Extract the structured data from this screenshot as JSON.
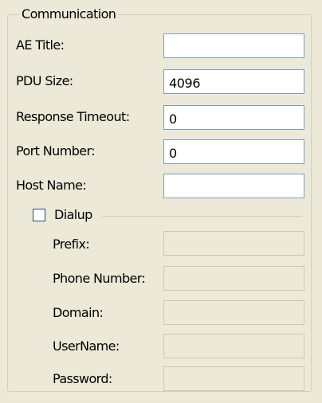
{
  "communication": {
    "group_title": "Communication",
    "fields": {
      "ae_title": {
        "label": "AE Title:",
        "value": ""
      },
      "pdu_size": {
        "label": "PDU Size:",
        "value": "4096"
      },
      "response_timeout": {
        "label": "Response Timeout:",
        "value": "0"
      },
      "port_number": {
        "label": "Port Number:",
        "value": "0"
      },
      "host_name": {
        "label": "Host Name:",
        "value": ""
      }
    },
    "dialup": {
      "label": "Dialup",
      "checked": false,
      "fields": {
        "prefix": {
          "label": "Prefix:",
          "value": ""
        },
        "phone_number": {
          "label": "Phone Number:",
          "value": ""
        },
        "domain": {
          "label": "Domain:",
          "value": ""
        },
        "username": {
          "label": "UserName:",
          "value": ""
        },
        "password": {
          "label": "Password:",
          "value": ""
        }
      }
    }
  },
  "colors": {
    "background": "#ece9d8",
    "field_border": "#7f9db9",
    "disabled_border": "#c9c7ba",
    "groupbox_border": "#d0d0bf"
  }
}
